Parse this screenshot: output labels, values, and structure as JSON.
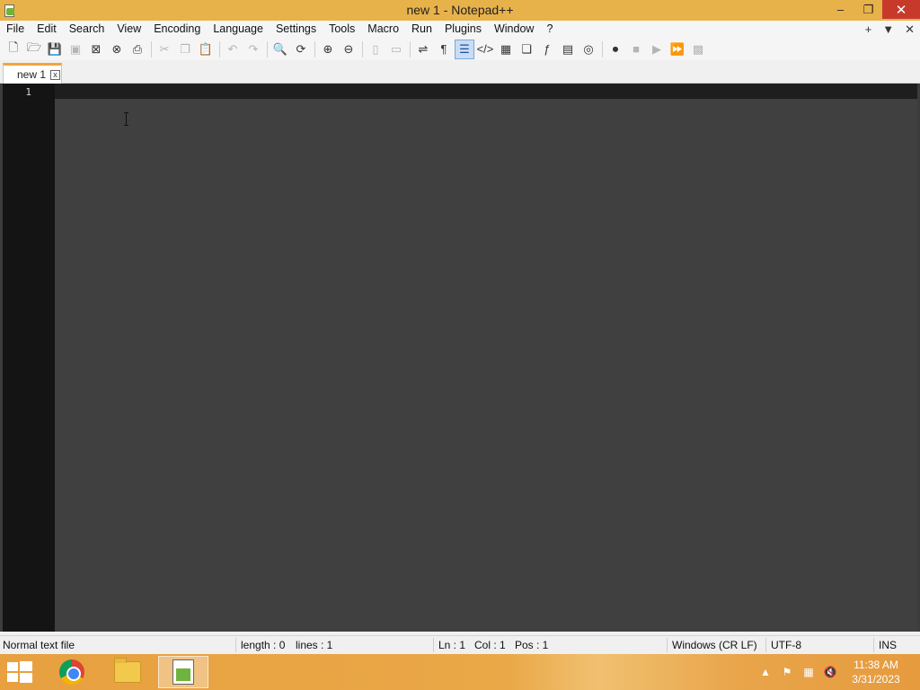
{
  "window": {
    "title": "new 1 - Notepad++",
    "controls": {
      "minimize": "–",
      "restore": "❐",
      "close": "✕"
    }
  },
  "menu": {
    "items": [
      "File",
      "Edit",
      "Search",
      "View",
      "Encoding",
      "Language",
      "Settings",
      "Tools",
      "Macro",
      "Run",
      "Plugins",
      "Window",
      "?"
    ],
    "right": {
      "add": "+",
      "dropdown": "▼",
      "close": "✕"
    }
  },
  "toolbar": {
    "icons": {
      "new": "new-file-icon",
      "open": "open-folder-icon",
      "save": "save-icon",
      "save_all": "save-all-icon",
      "close": "close-file-icon",
      "close_all": "close-all-icon",
      "print": "print-icon",
      "cut": "cut-icon",
      "copy": "copy-icon",
      "paste": "paste-icon",
      "undo": "undo-icon",
      "redo": "redo-icon",
      "find": "find-icon",
      "replace": "replace-icon",
      "zoom_in": "zoom-in-icon",
      "zoom_out": "zoom-out-icon",
      "word_wrap": "word-wrap-icon",
      "show_all": "pilcrow-icon",
      "indent_guide": "indent-guide-icon",
      "code": "code-icon",
      "function_list": "function-list-icon",
      "record": "record-macro-icon"
    }
  },
  "tabs": [
    {
      "label": "new 1",
      "close": "x"
    }
  ],
  "editor": {
    "line_numbers": [
      "1"
    ],
    "content": ""
  },
  "status": {
    "file_type": "Normal text file",
    "length": "length : 0",
    "lines": "lines : 1",
    "ln": "Ln : 1",
    "col": "Col : 1",
    "pos": "Pos : 1",
    "eol": "Windows (CR LF)",
    "encoding": "UTF-8",
    "mode": "INS"
  },
  "taskbar": {
    "apps": [
      "chrome-icon",
      "file-explorer-icon",
      "notepad-plus-plus-icon"
    ],
    "tray": {
      "show_hidden": "▲",
      "flag": "⚑",
      "network": "▦",
      "volume": "🔇"
    },
    "time": "11:38 AM",
    "date": "3/31/2023"
  },
  "colors": {
    "titlebar": "#e8b24a",
    "close_button": "#c73a2b",
    "editor_bg": "#404040",
    "gutter_bg": "#141414",
    "tab_accent": "#f2a53b"
  }
}
